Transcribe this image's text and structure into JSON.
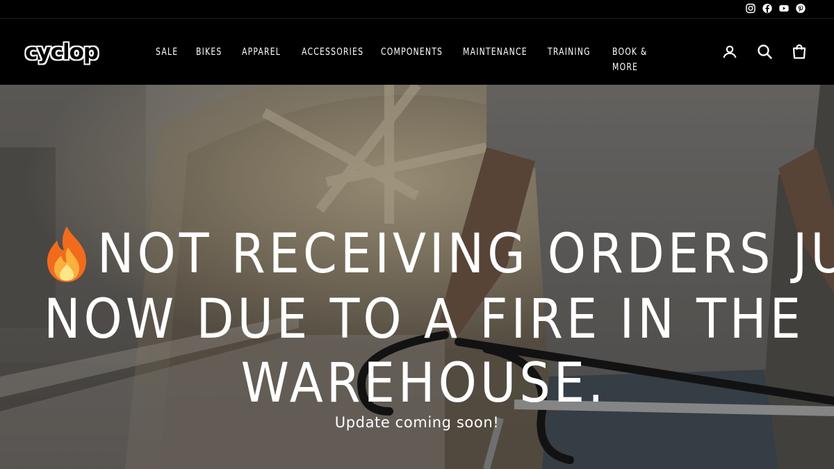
{
  "social": {
    "items": [
      {
        "name": "instagram-icon"
      },
      {
        "name": "facebook-icon"
      },
      {
        "name": "youtube-icon"
      },
      {
        "name": "pinterest-icon"
      }
    ]
  },
  "brand": {
    "logo_text": "cyclop"
  },
  "nav": {
    "items": [
      "SALE",
      "BIKES",
      "APPAREL",
      "ACCESSORIES",
      "COMPONENTS",
      "MAINTENANCE",
      "TRAINING",
      "BOOK & MORE"
    ]
  },
  "header_icons": [
    "account-icon",
    "search-icon",
    "cart-icon"
  ],
  "hero": {
    "headline_line1": "NOT RECEIVING ORDERS JUST",
    "headline_line2": "NOW DUE TO A FIRE IN THE",
    "headline_line3": "WAREHOUSE.",
    "headline_emoji": "fire-emoji-icon",
    "subline": "Update coming soon!"
  },
  "colors": {
    "background": "#000000",
    "text": "#ffffff"
  }
}
